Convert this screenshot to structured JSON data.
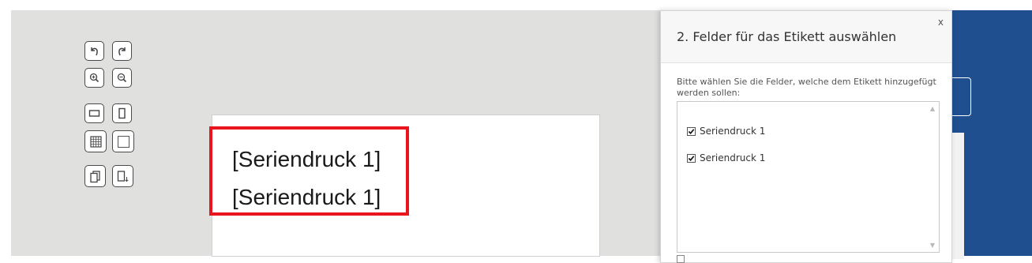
{
  "toolbar": {
    "icons": [
      "undo-icon",
      "redo-icon",
      "zoom-in-icon",
      "zoom-out-icon",
      "landscape-icon",
      "portrait-icon",
      "grid-icon",
      "no-grid-icon",
      "duplicate-page-icon",
      "page-down-icon"
    ]
  },
  "label": {
    "fields": [
      "[Seriendruck 1]",
      "[Seriendruck 1]"
    ],
    "highlight_color": "#e8141e"
  },
  "dialog": {
    "title": "2. Felder für das Etikett auswählen",
    "close": "x",
    "description": "Bitte wählen Sie die Felder, welche dem Etikett hinzugefügt werden sollen:",
    "items": [
      {
        "label": "Seriendruck 1",
        "checked": true
      },
      {
        "label": "Seriendruck 1",
        "checked": true
      }
    ]
  },
  "colors": {
    "workspace": "#e0e0de",
    "side_panel": "#1f4f8f"
  }
}
